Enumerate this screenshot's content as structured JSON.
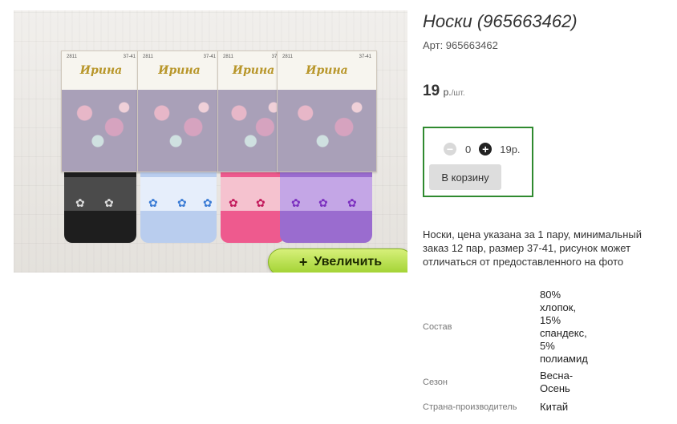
{
  "product": {
    "title": "Носки (965663462)",
    "article": "Арт: 965663462",
    "price": {
      "value": "19",
      "unit": "р.",
      "per": "/шт."
    },
    "description": "Носки, цена указана за 1 пару, минимальный заказ 12 пар, размер 37-41, рисунок может отличаться от предоставленного на фото"
  },
  "image": {
    "zoom_label": "Увеличить",
    "zoom_plus": "+",
    "brand": "Ирина",
    "code": "2811",
    "size": "37-41",
    "sock_colors": [
      "#1e1e1e",
      "#b9cdee",
      "#ee5a8e",
      "#9a6ccf"
    ],
    "band_colors": [
      "#4b4b4b",
      "#e6eefb",
      "#f5c2cf",
      "#c4a6e6"
    ]
  },
  "cart": {
    "minus": "−",
    "plus": "+",
    "quantity": "0",
    "sum": "19р.",
    "button_label": "В корзину",
    "border_color": "#2f8a2f"
  },
  "properties": [
    {
      "label": "Состав",
      "value": "80% хлопок, 15% спандекс, 5% полиамид"
    },
    {
      "label": "Сезон",
      "value": "Весна-Осень"
    },
    {
      "label": "Страна-производитель",
      "value": "Китай"
    }
  ]
}
